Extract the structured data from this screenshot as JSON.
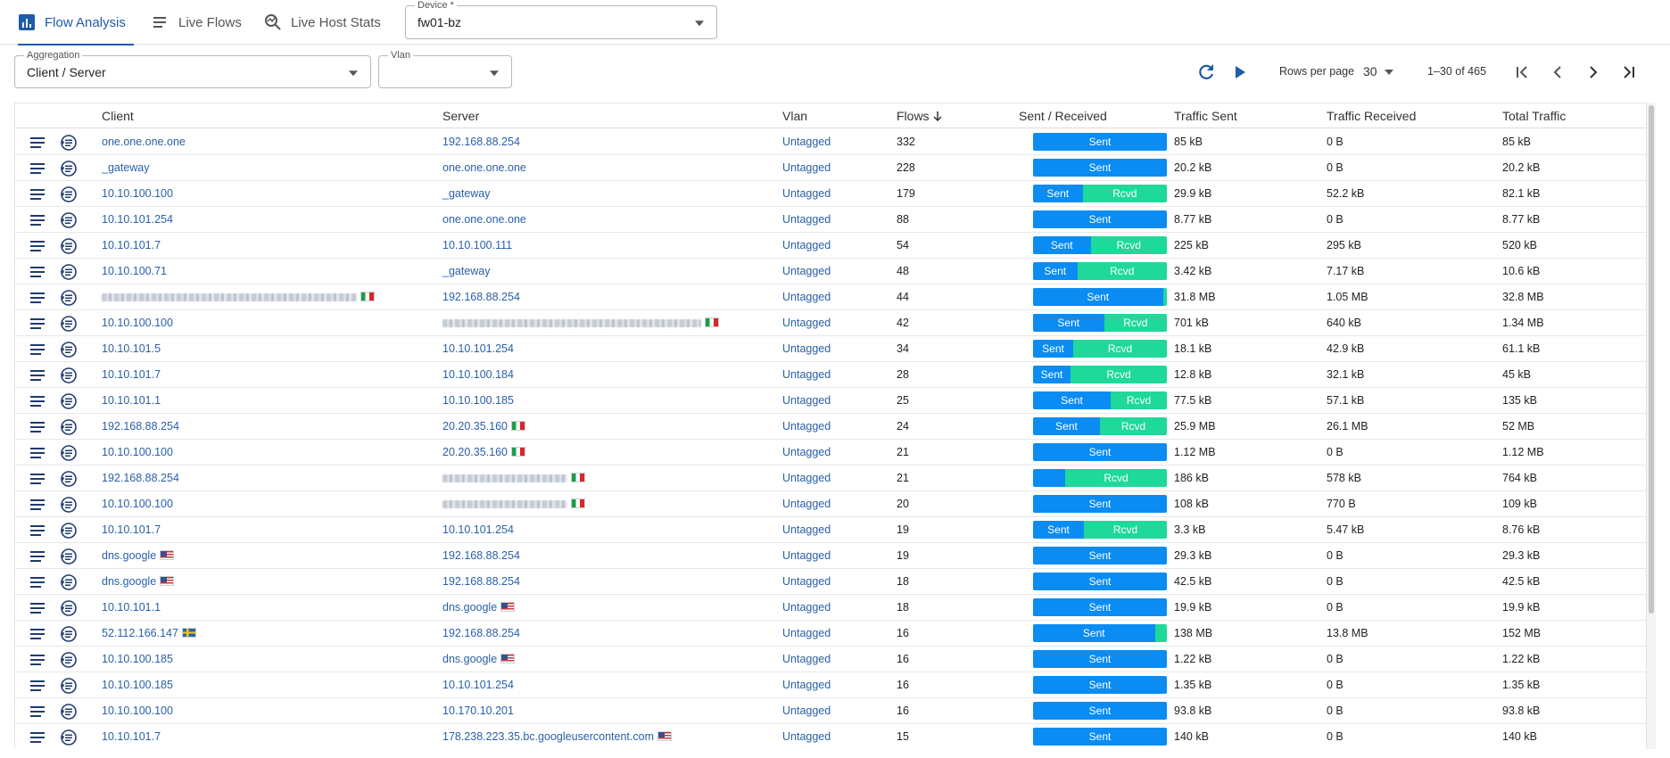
{
  "tabs": [
    {
      "label": "Flow Analysis",
      "icon": "bar-chart-icon",
      "active": true
    },
    {
      "label": "Live Flows",
      "icon": "list-icon",
      "active": false
    },
    {
      "label": "Live Host Stats",
      "icon": "zoom-stats-icon",
      "active": false
    }
  ],
  "device": {
    "label": "Device *",
    "value": "fw01-bz"
  },
  "aggregation": {
    "label": "Aggregation",
    "value": "Client / Server"
  },
  "vlan": {
    "label": "Vlan",
    "value": ""
  },
  "pager": {
    "rows_label": "Rows per page",
    "rows_value": "30",
    "range": "1–30 of 465"
  },
  "columns": {
    "client": "Client",
    "server": "Server",
    "vlan": "Vlan",
    "flows": "Flows",
    "sent_received": "Sent / Received",
    "traffic_sent": "Traffic Sent",
    "traffic_received": "Traffic Received",
    "total_traffic": "Total Traffic"
  },
  "colors": {
    "accent": "#1e5ba8",
    "sent": "#0a8cf2",
    "rcvd": "#1ed99a",
    "link": "#2a60a8"
  },
  "rows": [
    {
      "client": "one.one.one.one",
      "server": "192.168.88.254",
      "vlan": "Untagged",
      "flows": "332",
      "sent_pct": 100,
      "sent": "85 kB",
      "received": "0 B",
      "total": "85 kB"
    },
    {
      "client": "_gateway",
      "server": "one.one.one.one",
      "vlan": "Untagged",
      "flows": "228",
      "sent_pct": 100,
      "sent": "20.2 kB",
      "received": "0 B",
      "total": "20.2 kB"
    },
    {
      "client": "10.10.100.100",
      "server": "_gateway",
      "vlan": "Untagged",
      "flows": "179",
      "sent_pct": 37,
      "sent": "29.9 kB",
      "received": "52.2 kB",
      "total": "82.1 kB"
    },
    {
      "client": "10.10.101.254",
      "server": "one.one.one.one",
      "vlan": "Untagged",
      "flows": "88",
      "sent_pct": 100,
      "sent": "8.77 kB",
      "received": "0 B",
      "total": "8.77 kB"
    },
    {
      "client": "10.10.101.7",
      "server": "10.10.100.111",
      "vlan": "Untagged",
      "flows": "54",
      "sent_pct": 43,
      "sent": "225 kB",
      "received": "295 kB",
      "total": "520 kB"
    },
    {
      "client": "10.10.100.71",
      "server": "_gateway",
      "vlan": "Untagged",
      "flows": "48",
      "sent_pct": 33,
      "sent": "3.42 kB",
      "received": "7.17 kB",
      "total": "10.6 kB"
    },
    {
      "client_blur": 286,
      "client_flag": "it",
      "server": "192.168.88.254",
      "vlan": "Untagged",
      "flows": "44",
      "sent_pct": 97,
      "sent": "31.8 MB",
      "received": "1.05 MB",
      "total": "32.8 MB"
    },
    {
      "client": "10.10.100.100",
      "server_blur": 290,
      "server_flag": "it",
      "vlan": "Untagged",
      "flows": "42",
      "sent_pct": 53,
      "sent": "701 kB",
      "received": "640 kB",
      "total": "1.34 MB"
    },
    {
      "client": "10.10.101.5",
      "server": "10.10.101.254",
      "vlan": "Untagged",
      "flows": "34",
      "sent_pct": 30,
      "sent": "18.1 kB",
      "received": "42.9 kB",
      "total": "61.1 kB"
    },
    {
      "client": "10.10.101.7",
      "server": "10.10.100.184",
      "vlan": "Untagged",
      "flows": "28",
      "sent_pct": 28,
      "sent": "12.8 kB",
      "received": "32.1 kB",
      "total": "45 kB"
    },
    {
      "client": "10.10.101.1",
      "server": "10.10.100.185",
      "vlan": "Untagged",
      "flows": "25",
      "sent_pct": 58,
      "sent": "77.5 kB",
      "received": "57.1 kB",
      "total": "135 kB"
    },
    {
      "client": "192.168.88.254",
      "server": "20.20.35.160",
      "server_flag": "it",
      "vlan": "Untagged",
      "flows": "24",
      "sent_pct": 50,
      "sent": "25.9 MB",
      "received": "26.1 MB",
      "total": "52 MB"
    },
    {
      "client": "10.10.100.100",
      "server": "20.20.35.160",
      "server_flag": "it",
      "vlan": "Untagged",
      "flows": "21",
      "sent_pct": 100,
      "sent": "1.12 MB",
      "received": "0 B",
      "total": "1.12 MB"
    },
    {
      "client": "192.168.88.254",
      "server_blur": 140,
      "server_flag": "it",
      "vlan": "Untagged",
      "flows": "21",
      "sent_pct": 24,
      "sent": "186 kB",
      "received": "578 kB",
      "total": "764 kB"
    },
    {
      "client": "10.10.100.100",
      "server_blur": 140,
      "server_flag": "it",
      "vlan": "Untagged",
      "flows": "20",
      "sent_pct": 100,
      "sent": "108 kB",
      "received": "770 B",
      "total": "109 kB"
    },
    {
      "client": "10.10.101.7",
      "server": "10.10.101.254",
      "vlan": "Untagged",
      "flows": "19",
      "sent_pct": 38,
      "sent": "3.3 kB",
      "received": "5.47 kB",
      "total": "8.76 kB"
    },
    {
      "client": "dns.google",
      "client_flag": "us",
      "server": "192.168.88.254",
      "vlan": "Untagged",
      "flows": "19",
      "sent_pct": 100,
      "sent": "29.3 kB",
      "received": "0 B",
      "total": "29.3 kB"
    },
    {
      "client": "dns.google",
      "client_flag": "us",
      "server": "192.168.88.254",
      "vlan": "Untagged",
      "flows": "18",
      "sent_pct": 100,
      "sent": "42.5 kB",
      "received": "0 B",
      "total": "42.5 kB"
    },
    {
      "client": "10.10.101.1",
      "server": "dns.google",
      "server_flag": "us",
      "vlan": "Untagged",
      "flows": "18",
      "sent_pct": 100,
      "sent": "19.9 kB",
      "received": "0 B",
      "total": "19.9 kB"
    },
    {
      "client": "52.112.166.147",
      "client_flag": "se",
      "server": "192.168.88.254",
      "vlan": "Untagged",
      "flows": "16",
      "sent_pct": 91,
      "sent": "138 MB",
      "received": "13.8 MB",
      "total": "152 MB"
    },
    {
      "client": "10.10.100.185",
      "server": "dns.google",
      "server_flag": "us",
      "vlan": "Untagged",
      "flows": "16",
      "sent_pct": 100,
      "sent": "1.22 kB",
      "received": "0 B",
      "total": "1.22 kB"
    },
    {
      "client": "10.10.100.185",
      "server": "10.10.101.254",
      "vlan": "Untagged",
      "flows": "16",
      "sent_pct": 100,
      "sent": "1.35 kB",
      "received": "0 B",
      "total": "1.35 kB"
    },
    {
      "client": "10.10.100.100",
      "server": "10.170.10.201",
      "vlan": "Untagged",
      "flows": "16",
      "sent_pct": 100,
      "sent": "93.8 kB",
      "received": "0 B",
      "total": "93.8 kB"
    },
    {
      "client": "10.10.101.7",
      "server": "178.238.223.35.bc.googleusercontent.com",
      "server_flag": "us",
      "vlan": "Untagged",
      "flows": "15",
      "sent_pct": 100,
      "sent": "140 kB",
      "received": "0 B",
      "total": "140 kB"
    }
  ],
  "bar_labels": {
    "sent": "Sent",
    "rcvd": "Rcvd"
  }
}
